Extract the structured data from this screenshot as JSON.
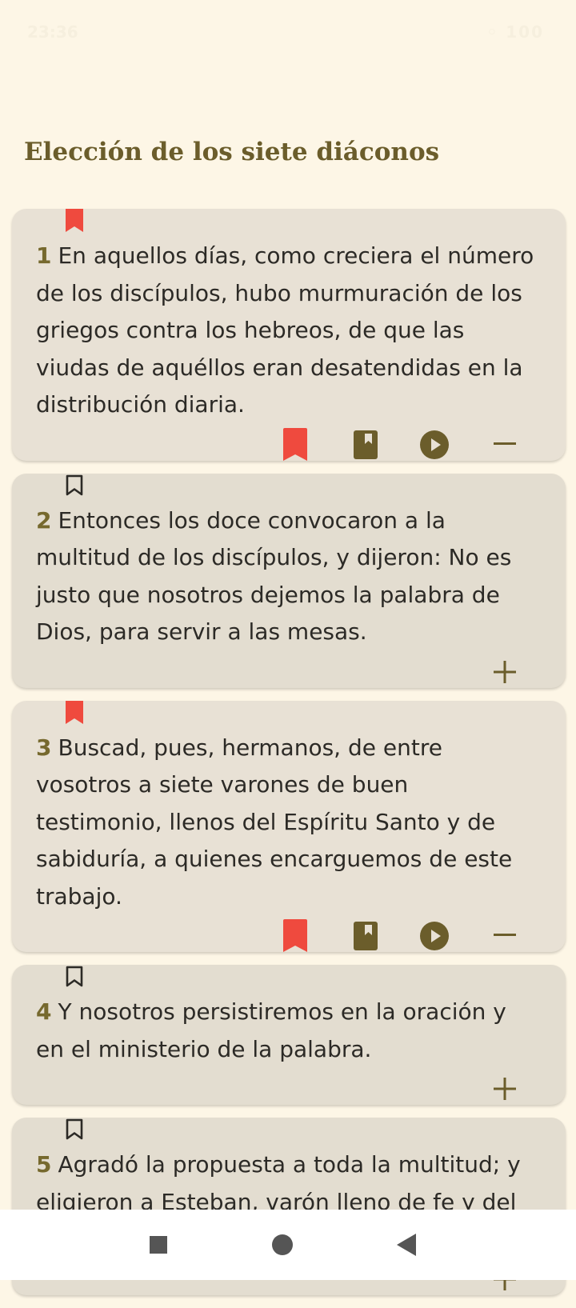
{
  "status_bar": {
    "time": "23:36",
    "icons": [
      "whatsapp-icon",
      "alarm-icon",
      "wifi-icon",
      "signal-icon",
      "battery-icon"
    ],
    "battery": "100"
  },
  "section_title": "Elección de los siete diáconos",
  "verses": [
    {
      "number": "1",
      "text": "En aquellos días,  como creciera el número de los discípulos,  hubo murmuración de los griegos contra los hebreos,  de que las viudas de aquéllos eran desatendidas en la distribución diaria.",
      "bookmarked": true,
      "expanded": true
    },
    {
      "number": "2",
      "text": "Entonces los doce convocaron a la multitud de los discípulos,  y dijeron:  No es justo que nosotros dejemos la palabra de Dios,  para servir a las mesas.",
      "bookmarked": false,
      "expanded": false
    },
    {
      "number": "3",
      "text": "Buscad,  pues,  hermanos,  de entre vosotros a siete varones de buen testimonio,  llenos del Espíritu Santo y de sabiduría,  a quienes encarguemos de este trabajo.",
      "bookmarked": true,
      "expanded": true
    },
    {
      "number": "4",
      "text": "Y nosotros persistiremos en la oración y en el ministerio de la palabra.",
      "bookmarked": false,
      "expanded": false
    },
    {
      "number": "5",
      "text": "Agradó la propuesta a toda la multitud; y eligieron a Esteban,  varón lleno de fe y del Espíritu Santo,  a Felipe,  a Prócoro,  a",
      "bookmarked": false,
      "expanded": false
    }
  ],
  "colors": {
    "background": "#fdf6e6",
    "card": "#e8e1d5",
    "accent": "#6b5d2b",
    "verse_number": "#76692e",
    "bookmark_red": "#ef4a3e"
  },
  "nav_bar": {
    "buttons": [
      "recents-square-icon",
      "home-circle-icon",
      "back-triangle-icon"
    ]
  }
}
